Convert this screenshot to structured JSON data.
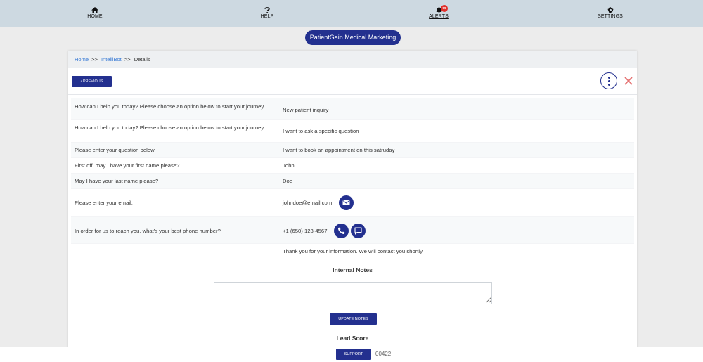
{
  "nav": {
    "home": "HOME",
    "help": "HELP",
    "alerts": "ALERTS",
    "alerts_badge": "99",
    "settings": "SETTINGS"
  },
  "brand": "PatientGain Medical Marketing",
  "breadcrumb": {
    "home": "Home",
    "sep1": ">>",
    "intellibot": "IntelliBot",
    "sep2": ">>",
    "current": "Details"
  },
  "toolbar": {
    "previous": "PREVIOUS"
  },
  "rows": [
    {
      "q": "How can I help you today? Please choose an option below to start your journey",
      "a": "New patient inquiry"
    },
    {
      "q": "How can I help you today? Please choose an option below to start your journey",
      "a": "I want to ask a specific question"
    },
    {
      "q": "Please enter your question below",
      "a": "I want to book an appointment on this satruday"
    },
    {
      "q": "First off, may I have your first name please?",
      "a": "John"
    },
    {
      "q": "May I have your last name please?",
      "a": "Doe"
    },
    {
      "q": "Please enter your email.",
      "a": "johndoe@email.com"
    },
    {
      "q": "In order for us to reach you, what's your best phone number?",
      "a": "+1 (650) 123-4567"
    },
    {
      "q": "",
      "a": "Thank you for your information. We will contact you shortly."
    }
  ],
  "notes": {
    "title": "Internal Notes",
    "value": "",
    "update": "UPDATE NOTES"
  },
  "lead_score": {
    "title": "Lead Score"
  },
  "footer": {
    "support": "SUPPORT",
    "code": "00422"
  },
  "colors": {
    "primary": "#23308f",
    "topbar": "#cdd9e1",
    "link": "#3a7bd5",
    "badge": "#e0302a",
    "close": "#e57373"
  }
}
